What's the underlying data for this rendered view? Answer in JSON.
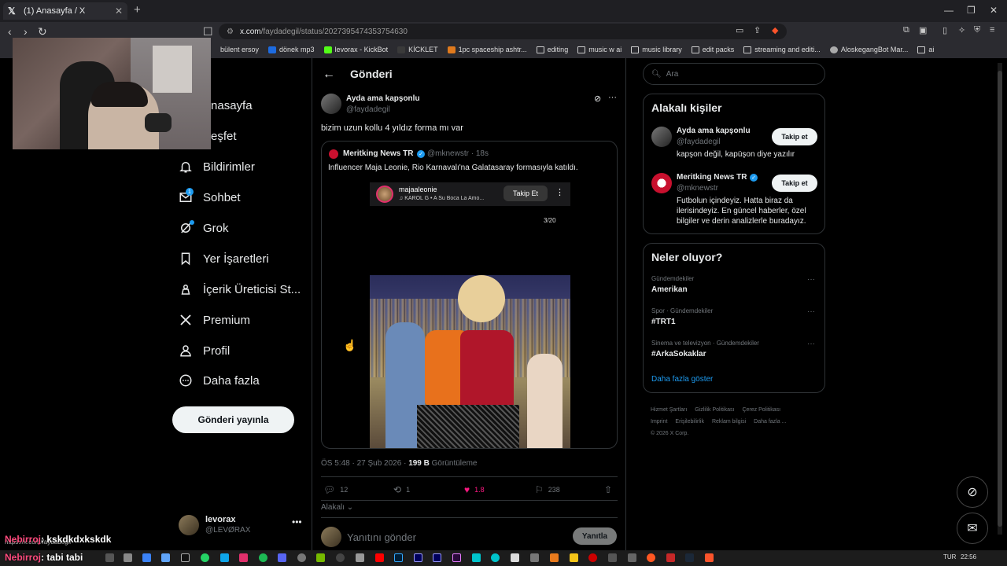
{
  "browser": {
    "tab_title": "(1) Anasayfa / X",
    "url_host": "x.com",
    "url_path": "/faydadegil/status/2027395474353754630",
    "bookmarks": [
      "bülent ersoy",
      "dönek mp3",
      "levorax - KickBot",
      "KİCKLET",
      "1pc spaceship ashtr...",
      "editing",
      "music w ai",
      "music library",
      "edit packs",
      "streaming and editi...",
      "AloskegangBot Mar...",
      "ai"
    ],
    "status_url": "https://x.com/faydadegil"
  },
  "nav": {
    "items": [
      {
        "label": "Anasayfa",
        "icon": "home-icon"
      },
      {
        "label": "Keşfet",
        "icon": "search-icon"
      },
      {
        "label": "Bildirimler",
        "icon": "bell-icon"
      },
      {
        "label": "Sohbet",
        "icon": "mail-icon",
        "badge": "1"
      },
      {
        "label": "Grok",
        "icon": "grok-icon"
      },
      {
        "label": "Yer İşaretleri",
        "icon": "bookmark-icon"
      },
      {
        "label": "İçerik Üreticisi St...",
        "icon": "creator-icon"
      },
      {
        "label": "Premium",
        "icon": "x-logo-icon"
      },
      {
        "label": "Profil",
        "icon": "person-icon"
      },
      {
        "label": "Daha fazla",
        "icon": "more-circle-icon"
      }
    ],
    "post_button": "Gönderi yayınla",
    "account_name": "levorax",
    "account_handle": "@LEVØRAX"
  },
  "main": {
    "title": "Gönderi",
    "author_name": "Ayda ama kapşonlu",
    "author_handle": "@faydadegil",
    "text": "bizim uzun kollu 4 yıldız forma mı var",
    "quote": {
      "name": "Meritking News TR",
      "handle_time": "@mknewstr · 18s",
      "text": "Influencer Maja Leonie, Rio Karnavalı'na Galatasaray formasıyla katıldı.",
      "ig_user": "majaaleonie",
      "ig_music": "♫ KAROL G • A Su Boca La Amo...",
      "ig_follow": "Takip Et",
      "ig_count": "3/20"
    },
    "meta_time": "ÖS 5:48 · 27 Şub 2026 · ",
    "meta_views_count": "199 B",
    "meta_views_label": " Görüntüleme",
    "actions": {
      "replies": "12",
      "reposts": "1",
      "likes": "1.8",
      "bookmarks": "238"
    },
    "relevant": "Alakalı",
    "reply_placeholder": "Yanıtını gönder",
    "reply_button": "Yanıtla"
  },
  "sidebar": {
    "search_placeholder": "Ara",
    "related_title": "Alakalı kişiler",
    "related": [
      {
        "name": "Ayda ama kapşonlu",
        "handle": "@faydadegil",
        "bio": "kapşon değil, kapüşon diye yazılır",
        "follow": "Takip et"
      },
      {
        "name": "Meritking News TR",
        "handle": "@mknewstr",
        "bio": "Futbolun içindeyiz. Hatta biraz da ilerisindeyiz. En güncel haberler, özel bilgiler ve derin analizlerle buradayız.",
        "follow": "Takip et"
      }
    ],
    "trends_title": "Neler oluyor?",
    "trends": [
      {
        "category": "Gündemdekiler",
        "name": "Amerikan"
      },
      {
        "category": "Spor · Gündemdekiler",
        "name": "#TRT1"
      },
      {
        "category": "Sinema ve televizyon · Gündemdekiler",
        "name": "#ArkaSokaklar"
      }
    ],
    "show_more": "Daha fazla göster",
    "footer": [
      "Hizmet Şartları",
      "Gizlilik Politikası",
      "Çerez Politikası",
      "Imprint",
      "Erişilebilirlik",
      "Reklam bilgisi",
      "Daha fazla ...",
      "© 2026 X Corp."
    ]
  },
  "chat": [
    {
      "user": "Nebirroj",
      "msg": ": kskdkdxkskdk"
    },
    {
      "user": "Nebirroj",
      "msg": ": tabi tabi"
    }
  ],
  "taskbar": {
    "lang": "TUR",
    "time": "22:56"
  },
  "colors": {
    "accent": "#1d9bf0",
    "like": "#f91880",
    "background": "#000000"
  }
}
